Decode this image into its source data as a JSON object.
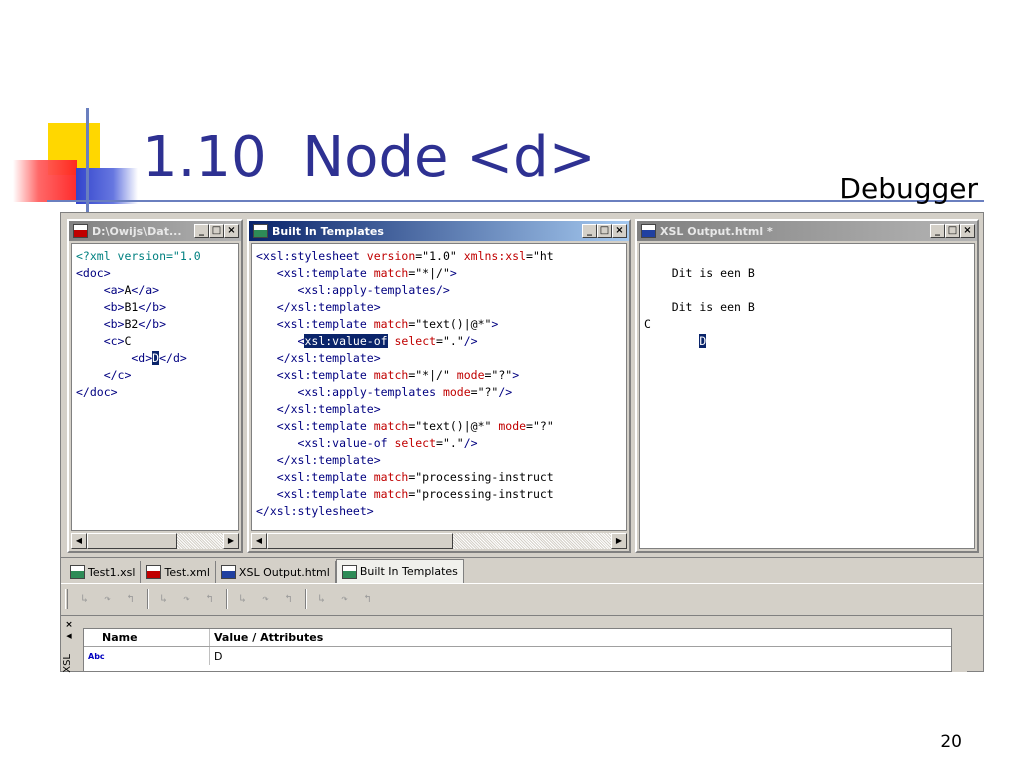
{
  "slide": {
    "title": "1.10  Node <d>",
    "subtitle": "Debugger",
    "page_number": "20"
  },
  "panes": {
    "xml": {
      "title": "D:\\Owijs\\Dat...",
      "icon": "xml-file-icon",
      "lines": [
        [
          {
            "t": "<?xml version=\"1.0",
            "c": "teal"
          }
        ],
        [
          {
            "t": "<doc>",
            "c": "blue"
          }
        ],
        [
          {
            "t": "    <a>",
            "c": "blue"
          },
          {
            "t": "A",
            "c": "black"
          },
          {
            "t": "</a>",
            "c": "blue"
          }
        ],
        [
          {
            "t": "    <b>",
            "c": "blue"
          },
          {
            "t": "B1",
            "c": "black"
          },
          {
            "t": "</b>",
            "c": "blue"
          }
        ],
        [
          {
            "t": "    <b>",
            "c": "blue"
          },
          {
            "t": "B2",
            "c": "black"
          },
          {
            "t": "</b>",
            "c": "blue"
          }
        ],
        [
          {
            "t": "    <c>",
            "c": "blue"
          },
          {
            "t": "C",
            "c": "black"
          }
        ],
        [
          {
            "t": "        <d>",
            "c": "blue"
          },
          {
            "t": "D",
            "c": "sel"
          },
          {
            "t": "</d>",
            "c": "blue"
          }
        ],
        [
          {
            "t": "    </c>",
            "c": "blue"
          }
        ],
        [
          {
            "t": "</doc>",
            "c": "blue"
          }
        ]
      ]
    },
    "templates": {
      "title": "Built In Templates",
      "icon": "xsl-file-icon",
      "lines": [
        [
          {
            "t": "<xsl:stylesheet ",
            "c": "blue"
          },
          {
            "t": "version",
            "c": "red"
          },
          {
            "t": "=\"1.0\" ",
            "c": "black"
          },
          {
            "t": "xmlns:xsl",
            "c": "red"
          },
          {
            "t": "=\"ht",
            "c": "black"
          }
        ],
        [
          {
            "t": "   <xsl:template ",
            "c": "blue"
          },
          {
            "t": "match",
            "c": "red"
          },
          {
            "t": "=\"*|/\"",
            "c": "black"
          },
          {
            "t": ">",
            "c": "blue"
          }
        ],
        [
          {
            "t": "      <xsl:apply-templates/>",
            "c": "blue"
          }
        ],
        [
          {
            "t": "   </xsl:template>",
            "c": "blue"
          }
        ],
        [
          {
            "t": "   <xsl:template ",
            "c": "blue"
          },
          {
            "t": "match",
            "c": "red"
          },
          {
            "t": "=\"text()|@*\"",
            "c": "black"
          },
          {
            "t": ">",
            "c": "blue"
          }
        ],
        [
          {
            "t": "      <",
            "c": "blue"
          },
          {
            "t": "xsl:value-of",
            "c": "sel"
          },
          {
            "t": " ",
            "c": "black"
          },
          {
            "t": "select",
            "c": "red"
          },
          {
            "t": "=\".\"",
            "c": "black"
          },
          {
            "t": "/>",
            "c": "blue"
          }
        ],
        [
          {
            "t": "   </xsl:template>",
            "c": "blue"
          }
        ],
        [
          {
            "t": "   <xsl:template ",
            "c": "blue"
          },
          {
            "t": "match",
            "c": "red"
          },
          {
            "t": "=\"*|/\" ",
            "c": "black"
          },
          {
            "t": "mode",
            "c": "red"
          },
          {
            "t": "=\"?\"",
            "c": "black"
          },
          {
            "t": ">",
            "c": "blue"
          }
        ],
        [
          {
            "t": "      <xsl:apply-templates ",
            "c": "blue"
          },
          {
            "t": "mode",
            "c": "red"
          },
          {
            "t": "=\"?\"",
            "c": "black"
          },
          {
            "t": "/>",
            "c": "blue"
          }
        ],
        [
          {
            "t": "   </xsl:template>",
            "c": "blue"
          }
        ],
        [
          {
            "t": "   <xsl:template ",
            "c": "blue"
          },
          {
            "t": "match",
            "c": "red"
          },
          {
            "t": "=\"text()|@*\" ",
            "c": "black"
          },
          {
            "t": "mode",
            "c": "red"
          },
          {
            "t": "=\"?\"",
            "c": "black"
          }
        ],
        [
          {
            "t": "      <xsl:value-of ",
            "c": "blue"
          },
          {
            "t": "select",
            "c": "red"
          },
          {
            "t": "=\".\"",
            "c": "black"
          },
          {
            "t": "/>",
            "c": "blue"
          }
        ],
        [
          {
            "t": "   </xsl:template>",
            "c": "blue"
          }
        ],
        [
          {
            "t": "   <xsl:template ",
            "c": "blue"
          },
          {
            "t": "match",
            "c": "red"
          },
          {
            "t": "=\"processing-instruct",
            "c": "black"
          }
        ],
        [
          {
            "t": "   <xsl:template ",
            "c": "blue"
          },
          {
            "t": "match",
            "c": "red"
          },
          {
            "t": "=\"processing-instruct",
            "c": "black"
          }
        ],
        [
          {
            "t": "</xsl:stylesheet>",
            "c": "blue"
          }
        ]
      ]
    },
    "output": {
      "title": "XSL Output.html *",
      "icon": "html-file-icon",
      "lines": [
        [
          {
            "t": "",
            "c": "black"
          }
        ],
        [
          {
            "t": "    Dit is een B",
            "c": "black"
          }
        ],
        [
          {
            "t": "",
            "c": "black"
          }
        ],
        [
          {
            "t": "    Dit is een B",
            "c": "black"
          }
        ],
        [
          {
            "t": "C",
            "c": "black"
          }
        ],
        [
          {
            "t": "        ",
            "c": "black"
          },
          {
            "t": "D",
            "c": "sel"
          }
        ]
      ]
    }
  },
  "window_buttons": {
    "minimize": "_",
    "maximize": "□",
    "close": "×"
  },
  "scroll_arrows": {
    "left": "◀",
    "right": "▶"
  },
  "tabs": [
    {
      "label": "Test1.xsl",
      "icon": "xsl-file-icon",
      "kind": "xsl",
      "active": false
    },
    {
      "label": "Test.xml",
      "icon": "xml-file-icon",
      "kind": "xml",
      "active": false
    },
    {
      "label": "XSL Output.html",
      "icon": "html-file-icon",
      "kind": "htm",
      "active": false
    },
    {
      "label": "Built In Templates",
      "icon": "xsl-file-icon",
      "kind": "xsl",
      "active": true
    }
  ],
  "toolbar": {
    "groups": [
      [
        "step-into-icon",
        "step-over-icon",
        "step-out-icon"
      ],
      [
        "run-to-cursor-icon",
        "breakpoint-icon",
        "clear-breakpoints-icon"
      ],
      [
        "start-debug-icon",
        "stop-debug-icon",
        "restart-icon"
      ],
      [
        "watch-icon",
        "locals-icon",
        "callstack-icon"
      ]
    ]
  },
  "properties": {
    "side_label": "XSL",
    "close_glyph": "×",
    "arrow_glyph": "◀",
    "columns": [
      "Name",
      "Value / Attributes"
    ],
    "rows": [
      {
        "icon": "abc-text-node-icon",
        "icon_text": "Abc",
        "name": "",
        "value": "D"
      }
    ]
  }
}
